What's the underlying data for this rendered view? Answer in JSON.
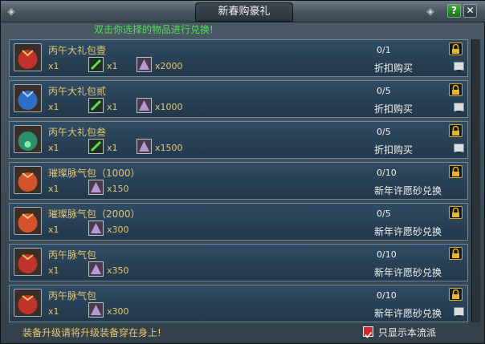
{
  "window": {
    "title": "新春购豪礼",
    "help_label": "?",
    "close_label": "✕"
  },
  "hint": "双击你选择的物品进行兑换!",
  "rows": [
    {
      "name": "丙午大礼包壹",
      "qty": "x1",
      "mat1_qty": "x1",
      "mat2_qty": "x2000",
      "count": "0/1",
      "action": "折扣购买",
      "icon_color": "#c0322c"
    },
    {
      "name": "丙午大礼包贰",
      "qty": "x1",
      "mat1_qty": "x1",
      "mat2_qty": "x1000",
      "count": "0/5",
      "action": "折扣购买",
      "icon_color": "#2f6ec7"
    },
    {
      "name": "丙午大礼包叁",
      "qty": "x1",
      "mat1_qty": "x1",
      "mat2_qty": "x1500",
      "count": "0/5",
      "action": "折扣购买",
      "icon_color": "#2a8f6c"
    },
    {
      "name": "璀璨脉气包（1000）",
      "qty": "x1",
      "mat2_qty": "x150",
      "count": "0/10",
      "action": "新年许愿砂兑换",
      "icon_color": "#d5522a"
    },
    {
      "name": "璀璨脉气包（2000）",
      "qty": "x1",
      "mat2_qty": "x300",
      "count": "0/5",
      "action": "新年许愿砂兑换",
      "icon_color": "#d5522a"
    },
    {
      "name": "丙午脉气包",
      "qty": "x1",
      "mat2_qty": "x350",
      "count": "0/10",
      "action": "新年许愿砂兑换",
      "icon_color": "#c0322c"
    },
    {
      "name": "丙午脉气包",
      "qty": "x1",
      "mat2_qty": "x300",
      "count": "0/10",
      "action": "新年许愿砂兑换",
      "icon_color": "#c0322c"
    }
  ],
  "footer": {
    "warning": "装备升级请将升级装备穿在身上!",
    "checkbox_label": "只显示本流派",
    "checkbox_checked": true
  }
}
